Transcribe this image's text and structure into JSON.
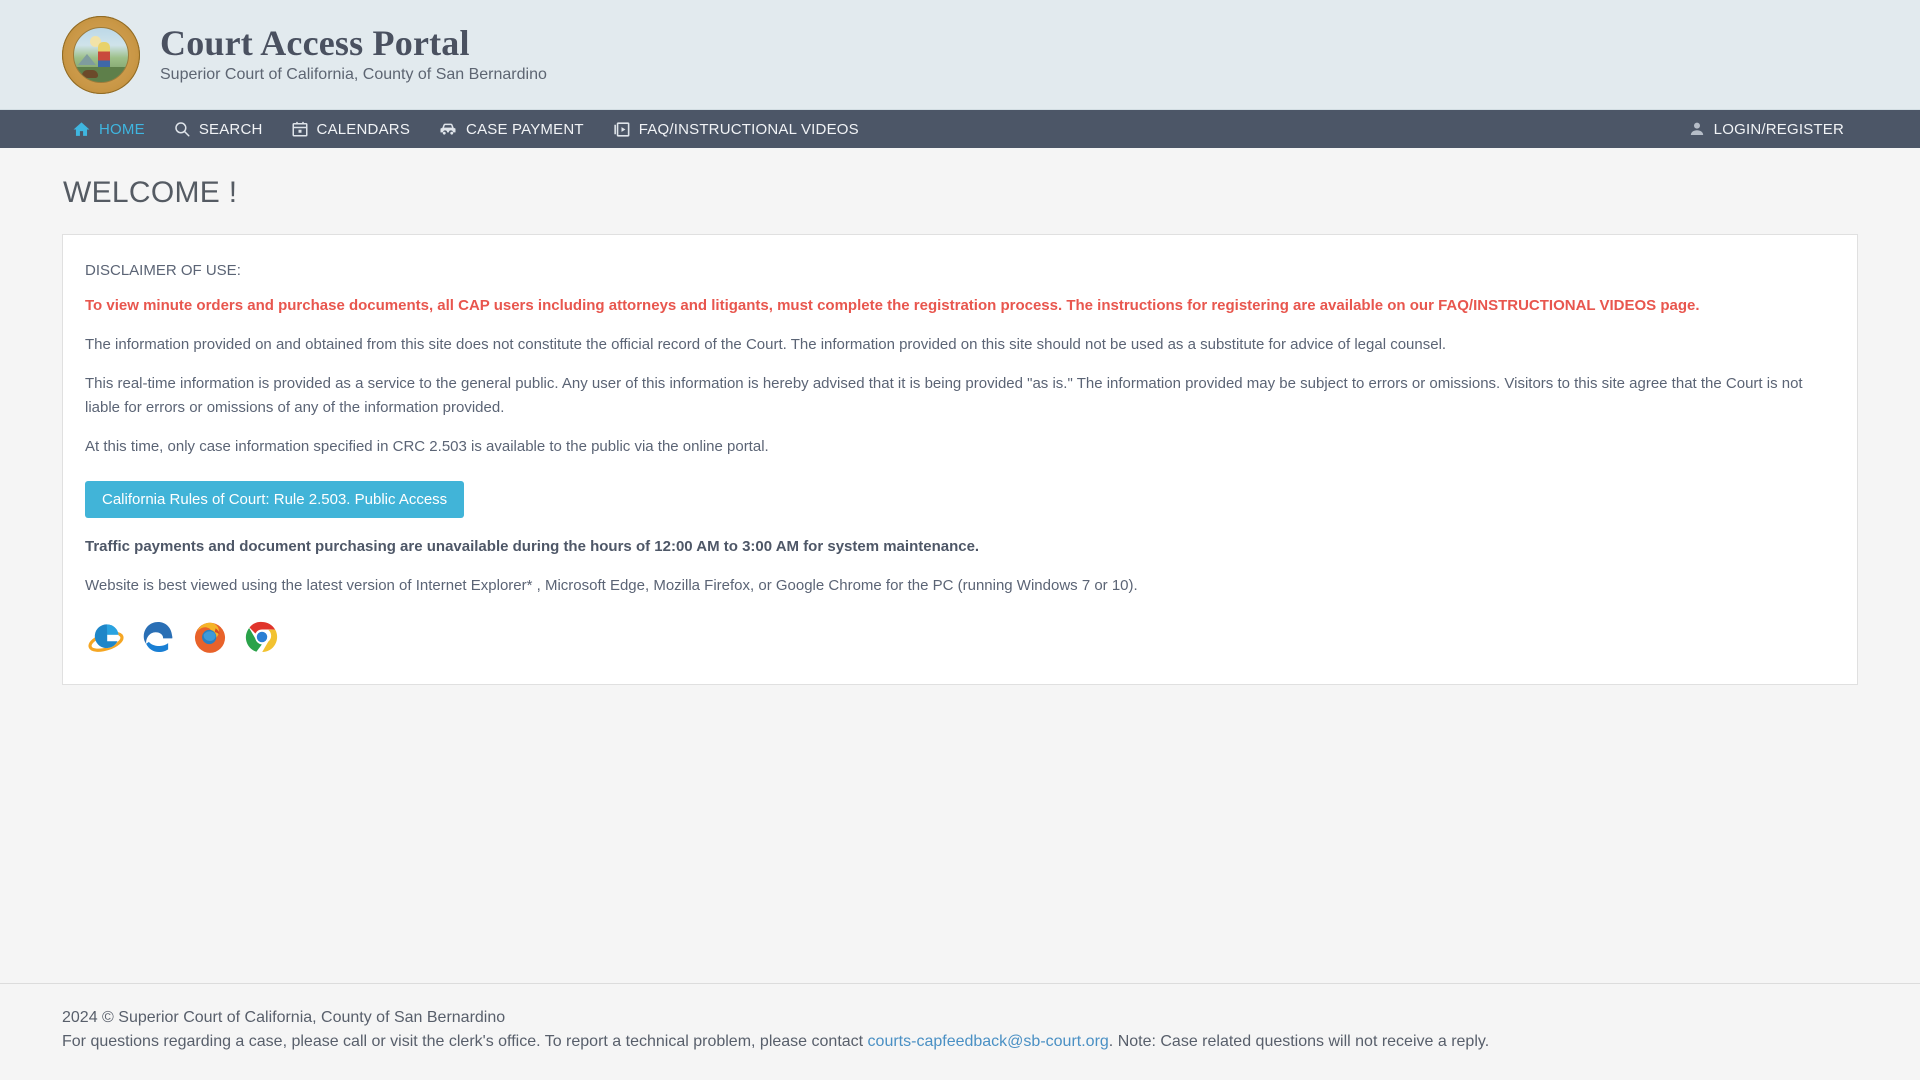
{
  "header": {
    "logo_name": "court-seal",
    "title": "Court Access Portal",
    "subtitle": "Superior Court of California, County of San Bernardino"
  },
  "nav": {
    "items": [
      {
        "label": "HOME",
        "icon": "home-icon",
        "active": true
      },
      {
        "label": "SEARCH",
        "icon": "search-icon",
        "active": false
      },
      {
        "label": "CALENDARS",
        "icon": "calendar-icon",
        "active": false
      },
      {
        "label": "CASE PAYMENT",
        "icon": "car-icon",
        "active": false
      },
      {
        "label": "FAQ/INSTRUCTIONAL VIDEOS",
        "icon": "video-icon",
        "active": false
      }
    ],
    "login": {
      "label": "LOGIN/REGISTER",
      "icon": "person-icon"
    },
    "active_color": "#3fb6e0",
    "background": "#4c5667"
  },
  "main": {
    "page_title": "WELCOME !",
    "disclaimer_heading": "DISCLAIMER OF USE:",
    "registration_notice": "To view minute orders and purchase documents, all CAP users including attorneys and litigants, must complete the registration process. The instructions for registering are available on our FAQ/INSTRUCTIONAL VIDEOS page.",
    "paragraph_official_record": "The information provided on and obtained from this site does not constitute the official record of the Court. The information provided on this site should not be used as a substitute for advice of legal counsel.",
    "paragraph_realtime": "This real-time information is provided as a service to the general public. Any user of this information is hereby advised that it is being provided \"as is.\" The information provided may be subject to errors or omissions. Visitors to this site agree that the Court is not liable for errors or omissions of any of the information provided.",
    "paragraph_crc": "At this time, only case information specified in CRC 2.503 is available to the public via the online portal.",
    "crc_button_label": "California Rules of Court: Rule 2.503. Public Access",
    "maintenance_notice": "Traffic payments and document purchasing are unavailable during the hours of 12:00 AM to 3:00 AM for system maintenance.",
    "browser_notice": "Website is best viewed using the latest version of Internet Explorer* , Microsoft Edge, Mozilla Firefox, or Google Chrome for the PC (running Windows 7 or 10).",
    "browsers": [
      {
        "name": "internet-explorer-icon"
      },
      {
        "name": "microsoft-edge-icon"
      },
      {
        "name": "mozilla-firefox-icon"
      },
      {
        "name": "google-chrome-icon"
      }
    ],
    "notice_color": "#e8564e",
    "button_color": "#41b4d8"
  },
  "footer": {
    "copyright": "2024 © Superior Court of California, County of San Bernardino",
    "contact_prefix": "For questions regarding a case, please call or visit the clerk's office. To report a technical problem, please contact ",
    "contact_email": "courts-capfeedback@sb-court.org",
    "contact_suffix": ". Note: Case related questions will not receive a reply."
  }
}
